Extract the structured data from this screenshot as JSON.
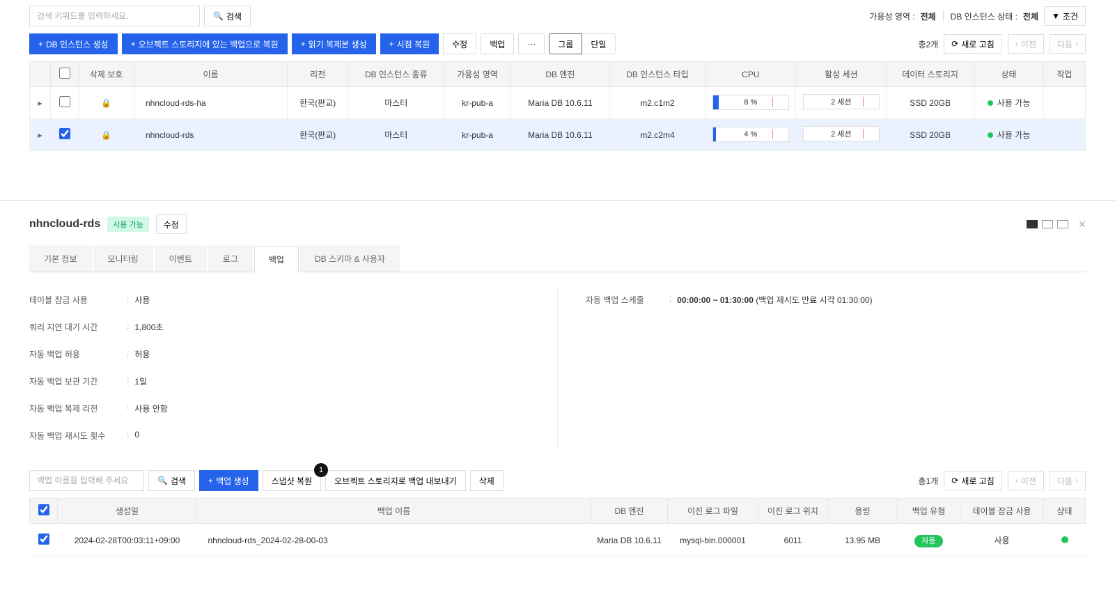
{
  "search": {
    "placeholder": "검색 키워드를 입력하세요.",
    "button": "검색"
  },
  "filters": {
    "availability_label": "가용성 영역 :",
    "availability_value": "전체",
    "status_label": "DB 인스턴스 상태 :",
    "status_value": "전체",
    "condition_button": "조건"
  },
  "actions": {
    "create_instance": "DB 인스턴스 생성",
    "restore_from_obs": "오브젝트 스토리지에 있는 백업으로 복원",
    "create_replica": "읽기 복제본 생성",
    "pitr": "시점 복원",
    "edit": "수정",
    "backup": "백업",
    "more": "···",
    "group": "그룹",
    "single": "단일",
    "total": "총2개",
    "refresh": "새로 고침",
    "prev": "이전",
    "next": "다음"
  },
  "table": {
    "headers": {
      "delete_protect": "삭제 보호",
      "name": "이름",
      "region": "리전",
      "type": "DB 인스턴스 종류",
      "az": "가용성 영역",
      "engine": "DB 엔진",
      "instance_type": "DB 인스턴스 타입",
      "cpu": "CPU",
      "sessions": "활성 세션",
      "storage": "데이터 스토리지",
      "status": "상태",
      "action": "작업"
    },
    "rows": [
      {
        "name": "nhncloud-rds-ha",
        "region": "한국(판교)",
        "type": "마스터",
        "az": "kr-pub-a",
        "engine": "Maria DB 10.6.11",
        "instance_type": "m2.c1m2",
        "cpu": "8 %",
        "sessions": "2 세션",
        "storage": "SSD 20GB",
        "status": "사용 가능",
        "selected": false
      },
      {
        "name": "nhncloud-rds",
        "region": "한국(판교)",
        "type": "마스터",
        "az": "kr-pub-a",
        "engine": "Maria DB 10.6.11",
        "instance_type": "m2.c2m4",
        "cpu": "4 %",
        "sessions": "2 세션",
        "storage": "SSD 20GB",
        "status": "사용 가능",
        "selected": true
      }
    ]
  },
  "detail": {
    "title": "nhncloud-rds",
    "status_badge": "사용 가능",
    "edit": "수정",
    "tabs": {
      "basic": "기본 정보",
      "monitoring": "모니터링",
      "event": "이벤트",
      "log": "로그",
      "backup": "백업",
      "schema": "DB 스키마 & 사용자"
    },
    "info": {
      "table_lock_label": "테이블 잠금 사용",
      "table_lock_value": "사용",
      "query_delay_label": "쿼리 지연 대기 시간",
      "query_delay_value": "1,800초",
      "auto_backup_label": "자동 백업 허용",
      "auto_backup_value": "허용",
      "retention_label": "자동 백업 보관 기간",
      "retention_value": "1일",
      "replica_region_label": "자동 백업 복제 리전",
      "replica_region_value": "사용 안함",
      "retry_label": "자동 백업 재시도 횟수",
      "retry_value": "0",
      "schedule_label": "자동 백업 스케줄",
      "schedule_value": "00:00:00 ~ 01:30:00",
      "schedule_note": "(백업 재시도 만료 시각 01:30:00)"
    }
  },
  "backup": {
    "search_placeholder": "백업 이름을 입력해 주세요.",
    "search_button": "검색",
    "create": "백업 생성",
    "snapshot_restore": "스냅샷 복원",
    "snapshot_badge": "1",
    "export_obs": "오브젝트 스토리지로 백업 내보내기",
    "delete": "삭제",
    "total": "총1개",
    "refresh": "새로 고침",
    "prev": "이전",
    "next": "다음",
    "headers": {
      "created": "생성일",
      "name": "백업 이름",
      "engine": "DB 엔진",
      "binlog_file": "이진 로그 파일",
      "binlog_pos": "이진 로그 위치",
      "size": "용량",
      "type": "백업 유형",
      "table_lock": "테이블 잠금 사용",
      "status": "상태"
    },
    "rows": [
      {
        "created": "2024-02-28T00:03:11+09:00",
        "name": "nhncloud-rds_2024-02-28-00-03",
        "engine": "Maria DB 10.6.11",
        "binlog_file": "mysql-bin.000001",
        "binlog_pos": "6011",
        "size": "13.95 MB",
        "type": "자동",
        "table_lock": "사용"
      }
    ]
  }
}
